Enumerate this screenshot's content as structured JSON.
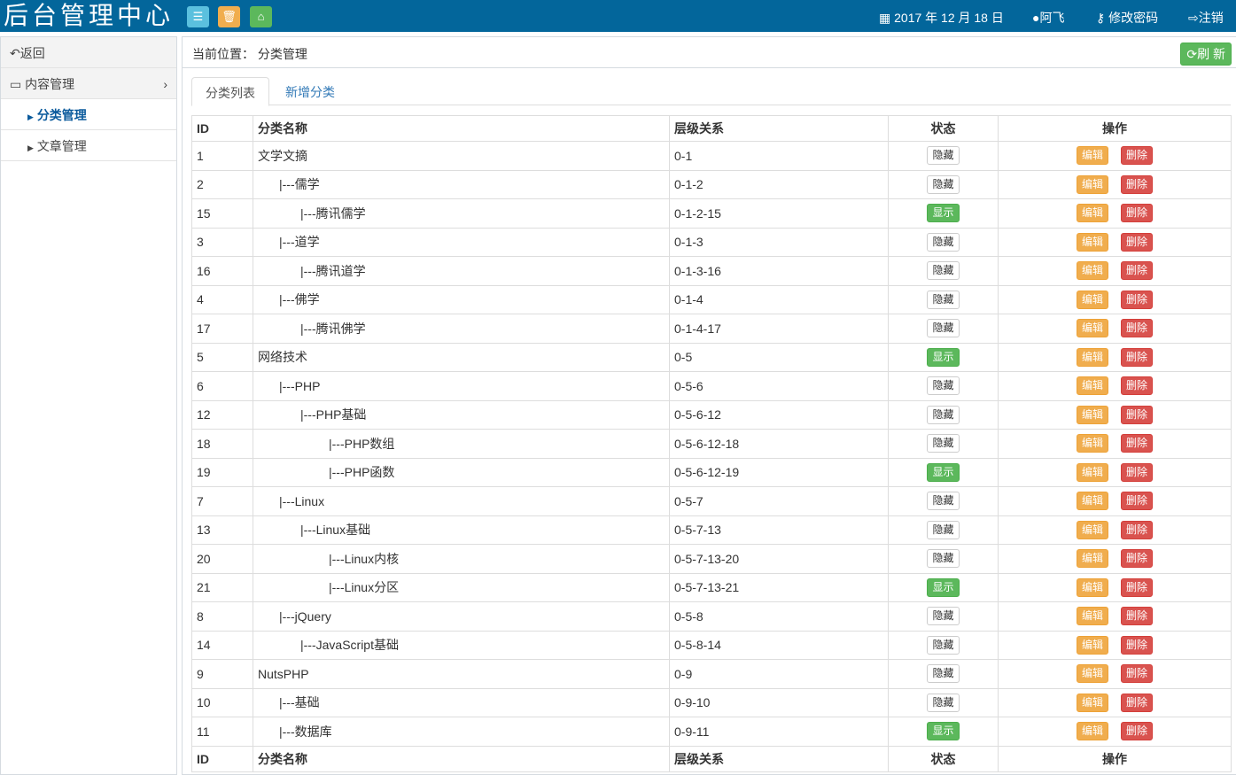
{
  "header": {
    "logo": "后台管理中心",
    "date": "2017 年 12 月 18 日",
    "user": "阿飞",
    "change_password": "修改密码",
    "logout": "注销"
  },
  "sidebar": {
    "back": "返回",
    "content": "内容管理",
    "items": [
      "分类管理",
      "文章管理"
    ]
  },
  "breadcrumb": {
    "label": "当前位置：",
    "current": "分类管理"
  },
  "refresh": "刷 新",
  "tabs": [
    "分类列表",
    "新增分类"
  ],
  "table": {
    "headers": [
      "ID",
      "分类名称",
      "层级关系",
      "状态",
      "操作"
    ],
    "edit": "编辑",
    "delete": "删除",
    "status_labels": {
      "hidden": "隐藏",
      "show": "显示"
    },
    "rows": [
      {
        "id": "1",
        "name": "文学文摘",
        "level": 0,
        "path": "0-1",
        "status": "hidden"
      },
      {
        "id": "2",
        "name": "|---儒学",
        "level": 1,
        "path": "0-1-2",
        "status": "hidden"
      },
      {
        "id": "15",
        "name": "|---腾讯儒学",
        "level": 2,
        "path": "0-1-2-15",
        "status": "show"
      },
      {
        "id": "3",
        "name": "|---道学",
        "level": 1,
        "path": "0-1-3",
        "status": "hidden"
      },
      {
        "id": "16",
        "name": "|---腾讯道学",
        "level": 2,
        "path": "0-1-3-16",
        "status": "hidden"
      },
      {
        "id": "4",
        "name": "|---佛学",
        "level": 1,
        "path": "0-1-4",
        "status": "hidden"
      },
      {
        "id": "17",
        "name": "|---腾讯佛学",
        "level": 2,
        "path": "0-1-4-17",
        "status": "hidden"
      },
      {
        "id": "5",
        "name": "网络技术",
        "level": 0,
        "path": "0-5",
        "status": "show"
      },
      {
        "id": "6",
        "name": "|---PHP",
        "level": 1,
        "path": "0-5-6",
        "status": "hidden"
      },
      {
        "id": "12",
        "name": "|---PHP基础",
        "level": 2,
        "path": "0-5-6-12",
        "status": "hidden"
      },
      {
        "id": "18",
        "name": "|---PHP数组",
        "level": 3,
        "path": "0-5-6-12-18",
        "status": "hidden"
      },
      {
        "id": "19",
        "name": "|---PHP函数",
        "level": 3,
        "path": "0-5-6-12-19",
        "status": "show"
      },
      {
        "id": "7",
        "name": "|---Linux",
        "level": 1,
        "path": "0-5-7",
        "status": "hidden"
      },
      {
        "id": "13",
        "name": "|---Linux基础",
        "level": 2,
        "path": "0-5-7-13",
        "status": "hidden"
      },
      {
        "id": "20",
        "name": "|---Linux内核",
        "level": 3,
        "path": "0-5-7-13-20",
        "status": "hidden"
      },
      {
        "id": "21",
        "name": "|---Linux分区",
        "level": 3,
        "path": "0-5-7-13-21",
        "status": "show"
      },
      {
        "id": "8",
        "name": "|---jQuery",
        "level": 1,
        "path": "0-5-8",
        "status": "hidden"
      },
      {
        "id": "14",
        "name": "|---JavaScript基础",
        "level": 2,
        "path": "0-5-8-14",
        "status": "hidden"
      },
      {
        "id": "9",
        "name": "NutsPHP",
        "level": 0,
        "path": "0-9",
        "status": "hidden"
      },
      {
        "id": "10",
        "name": "|---基础",
        "level": 1,
        "path": "0-9-10",
        "status": "hidden"
      },
      {
        "id": "11",
        "name": "|---数据库",
        "level": 1,
        "path": "0-9-11",
        "status": "show"
      }
    ]
  }
}
